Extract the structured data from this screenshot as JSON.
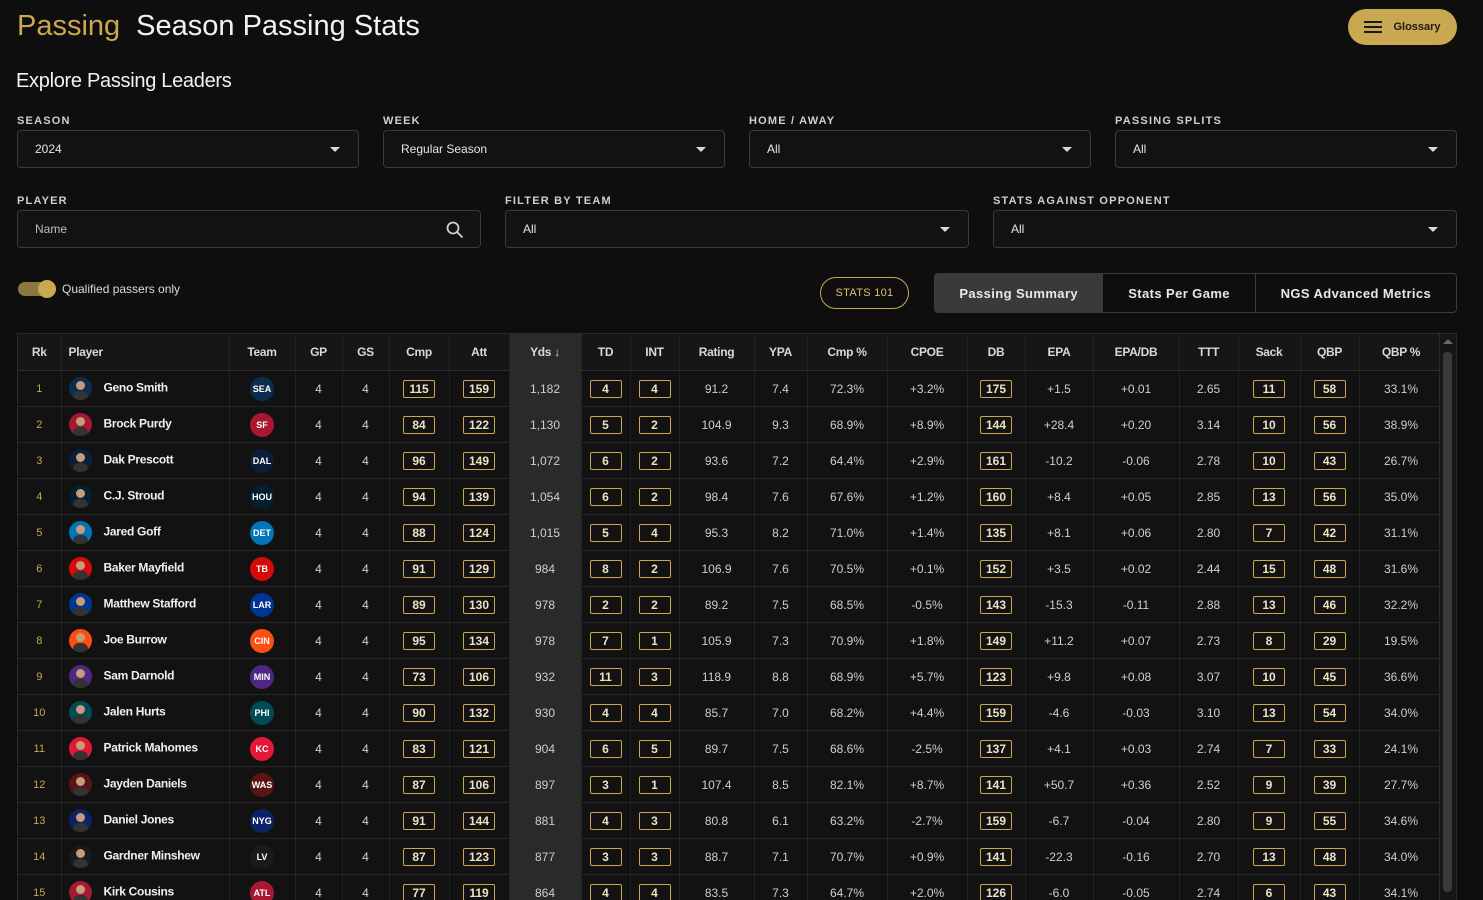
{
  "header": {
    "brand": "Passing",
    "title": "Season Passing Stats",
    "glossary_label": "Glossary"
  },
  "subtitle": "Explore Passing Leaders",
  "filters": {
    "season": {
      "label": "SEASON",
      "value": "2024"
    },
    "week": {
      "label": "WEEK",
      "value": "Regular Season"
    },
    "home_away": {
      "label": "HOME / AWAY",
      "value": "All"
    },
    "passing_splits": {
      "label": "PASSING SPLITS",
      "value": "All"
    },
    "player": {
      "label": "PLAYER",
      "placeholder": "Name"
    },
    "team": {
      "label": "FILTER BY TEAM",
      "value": "All"
    },
    "opponent": {
      "label": "STATS AGAINST OPPONENT",
      "value": "All"
    }
  },
  "toggle": {
    "label": "Qualified passers only",
    "on": true
  },
  "stats101_label": "STATS 101",
  "tabs": [
    "Passing Summary",
    "Stats Per Game",
    "NGS Advanced Metrics"
  ],
  "table": {
    "columns": [
      "Rk",
      "Player",
      "Team",
      "GP",
      "GS",
      "Cmp",
      "Att",
      "Yds ↓",
      "TD",
      "INT",
      "Rating",
      "YPA",
      "Cmp %",
      "CPOE",
      "DB",
      "EPA",
      "EPA/DB",
      "TTT",
      "Sack",
      "QBP",
      "QBP %"
    ],
    "rows": [
      {
        "rk": "1",
        "player": "Geno Smith",
        "team": "SEA",
        "color": "#0b2d4f",
        "gp": "4",
        "gs": "4",
        "cmp": "115",
        "att": "159",
        "yds": "1,182",
        "td": "4",
        "int": "4",
        "rating": "91.2",
        "ypa": "7.4",
        "cmp_pct": "72.3%",
        "cpoe": "+3.2%",
        "db": "175",
        "epa": "+1.5",
        "epa_db": "+0.01",
        "ttt": "2.65",
        "sack": "11",
        "qbp": "58",
        "qbp_pct": "33.1%"
      },
      {
        "rk": "2",
        "player": "Brock Purdy",
        "team": "SF",
        "color": "#a71930",
        "gp": "4",
        "gs": "4",
        "cmp": "84",
        "att": "122",
        "yds": "1,130",
        "td": "5",
        "int": "2",
        "rating": "104.9",
        "ypa": "9.3",
        "cmp_pct": "68.9%",
        "cpoe": "+8.9%",
        "db": "144",
        "epa": "+28.4",
        "epa_db": "+0.20",
        "ttt": "3.14",
        "sack": "10",
        "qbp": "56",
        "qbp_pct": "38.9%"
      },
      {
        "rk": "3",
        "player": "Dak Prescott",
        "team": "DAL",
        "color": "#0b1f3a",
        "gp": "4",
        "gs": "4",
        "cmp": "96",
        "att": "149",
        "yds": "1,072",
        "td": "6",
        "int": "2",
        "rating": "93.6",
        "ypa": "7.2",
        "cmp_pct": "64.4%",
        "cpoe": "+2.9%",
        "db": "161",
        "epa": "-10.2",
        "epa_db": "-0.06",
        "ttt": "2.78",
        "sack": "10",
        "qbp": "43",
        "qbp_pct": "26.7%"
      },
      {
        "rk": "4",
        "player": "C.J. Stroud",
        "team": "HOU",
        "color": "#03202f",
        "gp": "4",
        "gs": "4",
        "cmp": "94",
        "att": "139",
        "yds": "1,054",
        "td": "6",
        "int": "2",
        "rating": "98.4",
        "ypa": "7.6",
        "cmp_pct": "67.6%",
        "cpoe": "+1.2%",
        "db": "160",
        "epa": "+8.4",
        "epa_db": "+0.05",
        "ttt": "2.85",
        "sack": "13",
        "qbp": "56",
        "qbp_pct": "35.0%"
      },
      {
        "rk": "5",
        "player": "Jared Goff",
        "team": "DET",
        "color": "#0076b6",
        "gp": "4",
        "gs": "4",
        "cmp": "88",
        "att": "124",
        "yds": "1,015",
        "td": "5",
        "int": "4",
        "rating": "95.3",
        "ypa": "8.2",
        "cmp_pct": "71.0%",
        "cpoe": "+1.4%",
        "db": "135",
        "epa": "+8.1",
        "epa_db": "+0.06",
        "ttt": "2.80",
        "sack": "7",
        "qbp": "42",
        "qbp_pct": "31.1%"
      },
      {
        "rk": "6",
        "player": "Baker Mayfield",
        "team": "TB",
        "color": "#d50a0a",
        "gp": "4",
        "gs": "4",
        "cmp": "91",
        "att": "129",
        "yds": "984",
        "td": "8",
        "int": "2",
        "rating": "106.9",
        "ypa": "7.6",
        "cmp_pct": "70.5%",
        "cpoe": "+0.1%",
        "db": "152",
        "epa": "+3.5",
        "epa_db": "+0.02",
        "ttt": "2.44",
        "sack": "15",
        "qbp": "48",
        "qbp_pct": "31.6%"
      },
      {
        "rk": "7",
        "player": "Matthew Stafford",
        "team": "LAR",
        "color": "#003594",
        "gp": "4",
        "gs": "4",
        "cmp": "89",
        "att": "130",
        "yds": "978",
        "td": "2",
        "int": "2",
        "rating": "89.2",
        "ypa": "7.5",
        "cmp_pct": "68.5%",
        "cpoe": "-0.5%",
        "db": "143",
        "epa": "-15.3",
        "epa_db": "-0.11",
        "ttt": "2.88",
        "sack": "13",
        "qbp": "46",
        "qbp_pct": "32.2%"
      },
      {
        "rk": "8",
        "player": "Joe Burrow",
        "team": "CIN",
        "color": "#fb4f14",
        "gp": "4",
        "gs": "4",
        "cmp": "95",
        "att": "134",
        "yds": "978",
        "td": "7",
        "int": "1",
        "rating": "105.9",
        "ypa": "7.3",
        "cmp_pct": "70.9%",
        "cpoe": "+1.8%",
        "db": "149",
        "epa": "+11.2",
        "epa_db": "+0.07",
        "ttt": "2.73",
        "sack": "8",
        "qbp": "29",
        "qbp_pct": "19.5%"
      },
      {
        "rk": "9",
        "player": "Sam Darnold",
        "team": "MIN",
        "color": "#4f2683",
        "gp": "4",
        "gs": "4",
        "cmp": "73",
        "att": "106",
        "yds": "932",
        "td": "11",
        "int": "3",
        "rating": "118.9",
        "ypa": "8.8",
        "cmp_pct": "68.9%",
        "cpoe": "+5.7%",
        "db": "123",
        "epa": "+9.8",
        "epa_db": "+0.08",
        "ttt": "3.07",
        "sack": "10",
        "qbp": "45",
        "qbp_pct": "36.6%"
      },
      {
        "rk": "10",
        "player": "Jalen Hurts",
        "team": "PHI",
        "color": "#004c54",
        "gp": "4",
        "gs": "4",
        "cmp": "90",
        "att": "132",
        "yds": "930",
        "td": "4",
        "int": "4",
        "rating": "85.7",
        "ypa": "7.0",
        "cmp_pct": "68.2%",
        "cpoe": "+4.4%",
        "db": "159",
        "epa": "-4.6",
        "epa_db": "-0.03",
        "ttt": "3.10",
        "sack": "13",
        "qbp": "54",
        "qbp_pct": "34.0%"
      },
      {
        "rk": "11",
        "player": "Patrick Mahomes",
        "team": "KC",
        "color": "#e31837",
        "gp": "4",
        "gs": "4",
        "cmp": "83",
        "att": "121",
        "yds": "904",
        "td": "6",
        "int": "5",
        "rating": "89.7",
        "ypa": "7.5",
        "cmp_pct": "68.6%",
        "cpoe": "-2.5%",
        "db": "137",
        "epa": "+4.1",
        "epa_db": "+0.03",
        "ttt": "2.74",
        "sack": "7",
        "qbp": "33",
        "qbp_pct": "24.1%"
      },
      {
        "rk": "12",
        "player": "Jayden Daniels",
        "team": "WAS",
        "color": "#5a1414",
        "gp": "4",
        "gs": "4",
        "cmp": "87",
        "att": "106",
        "yds": "897",
        "td": "3",
        "int": "1",
        "rating": "107.4",
        "ypa": "8.5",
        "cmp_pct": "82.1%",
        "cpoe": "+8.7%",
        "db": "141",
        "epa": "+50.7",
        "epa_db": "+0.36",
        "ttt": "2.52",
        "sack": "9",
        "qbp": "39",
        "qbp_pct": "27.7%"
      },
      {
        "rk": "13",
        "player": "Daniel Jones",
        "team": "NYG",
        "color": "#0b2265",
        "gp": "4",
        "gs": "4",
        "cmp": "91",
        "att": "144",
        "yds": "881",
        "td": "4",
        "int": "3",
        "rating": "80.8",
        "ypa": "6.1",
        "cmp_pct": "63.2%",
        "cpoe": "-2.7%",
        "db": "159",
        "epa": "-6.7",
        "epa_db": "-0.04",
        "ttt": "2.80",
        "sack": "9",
        "qbp": "55",
        "qbp_pct": "34.6%"
      },
      {
        "rk": "14",
        "player": "Gardner Minshew",
        "team": "LV",
        "color": "#1a1a1a",
        "gp": "4",
        "gs": "4",
        "cmp": "87",
        "att": "123",
        "yds": "877",
        "td": "3",
        "int": "3",
        "rating": "88.7",
        "ypa": "7.1",
        "cmp_pct": "70.7%",
        "cpoe": "+0.9%",
        "db": "141",
        "epa": "-22.3",
        "epa_db": "-0.16",
        "ttt": "2.70",
        "sack": "13",
        "qbp": "48",
        "qbp_pct": "34.0%"
      },
      {
        "rk": "15",
        "player": "Kirk Cousins",
        "team": "ATL",
        "color": "#a71930",
        "gp": "4",
        "gs": "4",
        "cmp": "77",
        "att": "119",
        "yds": "864",
        "td": "4",
        "int": "4",
        "rating": "83.5",
        "ypa": "7.3",
        "cmp_pct": "64.7%",
        "cpoe": "+2.0%",
        "db": "126",
        "epa": "-6.0",
        "epa_db": "-0.05",
        "ttt": "2.74",
        "sack": "6",
        "qbp": "43",
        "qbp_pct": "34.1%"
      }
    ]
  },
  "colors": {
    "accent": "#c9a851",
    "background": "#0e0e0e"
  }
}
